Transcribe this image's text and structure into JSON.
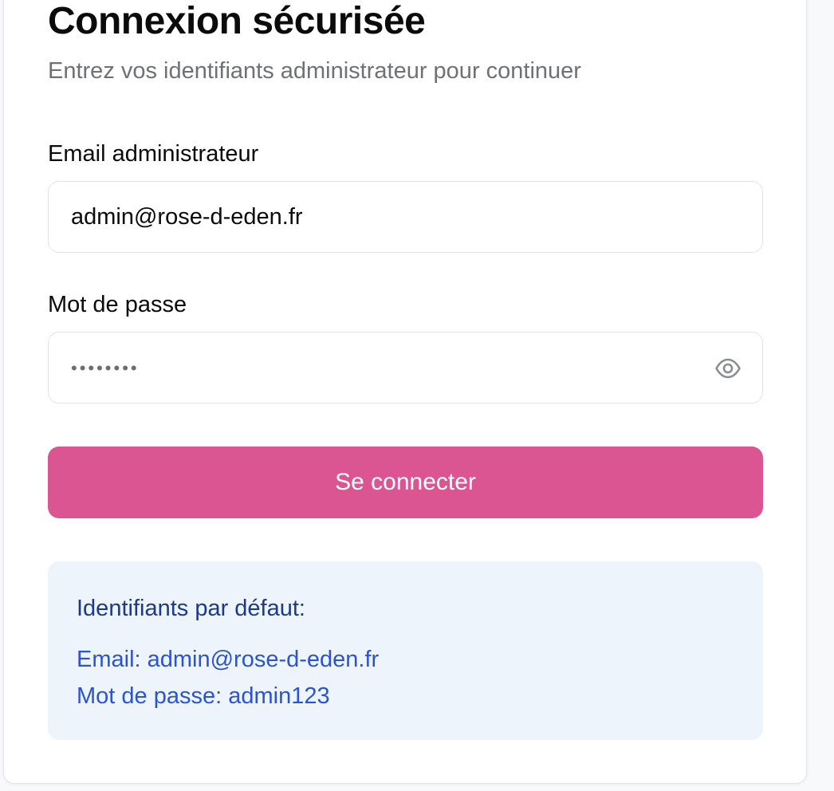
{
  "header": {
    "title": "Connexion sécurisée",
    "subtitle": "Entrez vos identifiants administrateur pour continuer"
  },
  "form": {
    "email_label": "Email administrateur",
    "email_value": "admin@rose-d-eden.fr",
    "password_label": "Mot de passe",
    "password_masked": "••••••••",
    "password_toggle_icon": "eye-icon",
    "submit_label": "Se connecter"
  },
  "defaults_box": {
    "title": "Identifiants par défaut:",
    "email_line": "Email: admin@rose-d-eden.fr",
    "password_line": "Mot de passe: admin123"
  },
  "colors": {
    "primary_button": "#da5592",
    "info_background": "#eef4fc",
    "info_title": "#1d3a8a",
    "info_text": "#2b55d0"
  }
}
